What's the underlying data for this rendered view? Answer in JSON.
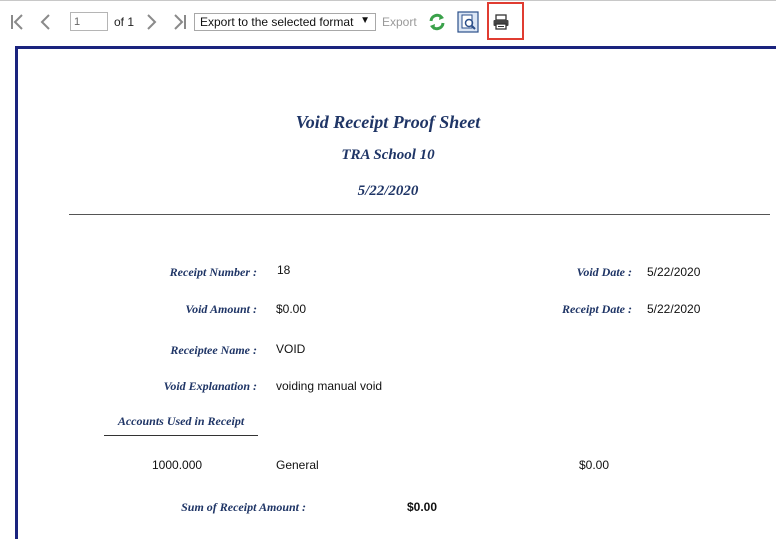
{
  "toolbar": {
    "page_value": "1",
    "page_of": "of 1",
    "format_selected": "Export to the selected format",
    "export_label": "Export"
  },
  "report": {
    "title": "Void Receipt Proof Sheet",
    "school": "TRA School 10",
    "date": "5/22/2020",
    "fields": {
      "receipt_number_label": "Receipt Number :",
      "receipt_number": "18",
      "void_date_label": "Void Date :",
      "void_date": "5/22/2020",
      "void_amount_label": "Void Amount :",
      "void_amount": "$0.00",
      "receipt_date_label": "Receipt Date :",
      "receipt_date": "5/22/2020",
      "receiptee_name_label": "Receiptee Name :",
      "receiptee_name": "VOID",
      "void_explanation_label": "Void Explanation :",
      "void_explanation": "voiding manual void"
    },
    "accounts_header": "Accounts Used in Receipt",
    "accounts": [
      {
        "number": "1000.000",
        "name": "General",
        "amount": "$0.00"
      }
    ],
    "sum_label": "Sum of Receipt Amount :",
    "sum_value": "$0.00"
  },
  "colors": {
    "heading": "#1f3566",
    "frame": "#1a237e",
    "highlight": "#e03c31",
    "refresh": "#3aa14a"
  }
}
